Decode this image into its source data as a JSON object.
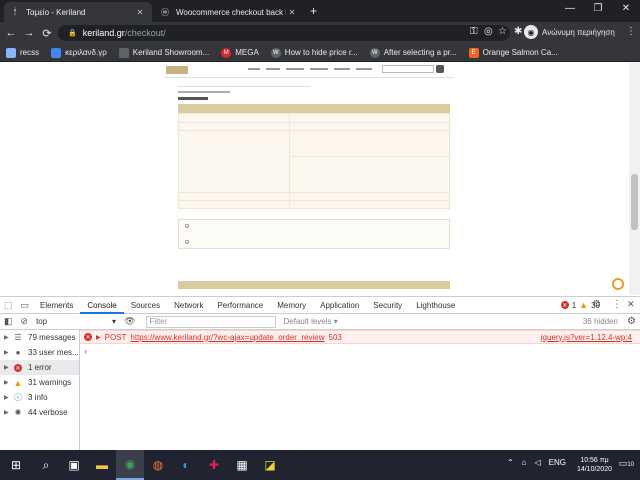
{
  "browser": {
    "tabs": [
      {
        "title": "Ταμείο - Keriland",
        "active": true
      },
      {
        "title": "Woocommerce checkout back 50",
        "active": false
      }
    ],
    "address": {
      "host": "keriland.gr",
      "path": "/checkout/"
    },
    "profile": {
      "label": "Ανώνυμη περιήγηση"
    },
    "bookmarks": [
      {
        "label": "recss",
        "icon": "bookmark-icon",
        "color": "#8ab4f8"
      },
      {
        "label": "κεριλανδ.γρ",
        "icon": "cloud-icon",
        "color": "#4285f4"
      },
      {
        "label": "Keriland Showroom...",
        "icon": "folder-icon",
        "color": "#5f6368"
      },
      {
        "label": "MEGA",
        "icon": "mega-icon",
        "color": "#d9272e"
      },
      {
        "label": "How to hide price r...",
        "icon": "wordpress-icon",
        "color": "#5f6368"
      },
      {
        "label": "After selecting a pr...",
        "icon": "wordpress-icon",
        "color": "#5f6368"
      },
      {
        "label": "Orange Salmon Ca...",
        "icon": "etsy-icon",
        "color": "#f1641e"
      }
    ]
  },
  "devtools": {
    "tabs": [
      "Elements",
      "Console",
      "Sources",
      "Network",
      "Performance",
      "Memory",
      "Application",
      "Security",
      "Lighthouse"
    ],
    "active_tab": "Console",
    "error_count": "1",
    "warning_count": "30",
    "context": "top",
    "filter_placeholder": "Filter",
    "levels": "Default levels ▾",
    "hidden": "36 hidden",
    "sidebar": [
      {
        "label": "79 messages",
        "icon": "list-icon"
      },
      {
        "label": "33 user mes...",
        "icon": "user-icon"
      },
      {
        "label": "1 error",
        "icon": "error-icon"
      },
      {
        "label": "31 warnings",
        "icon": "warning-icon"
      },
      {
        "label": "3 info",
        "icon": "info-icon"
      },
      {
        "label": "44 verbose",
        "icon": "verbose-icon"
      }
    ],
    "selected_sidebar": 2,
    "error_row": {
      "method": "POST",
      "url": "https://www.keriland.gr/?wc-ajax=update_order_review",
      "status": "503",
      "source": "jquery.js?ver=1.12.4-wp:4"
    }
  },
  "taskbar": {
    "tray": {
      "lang": "ENG"
    },
    "clock": {
      "time": "10:56 πμ",
      "date": "14/10/2020"
    },
    "notifications": "10"
  }
}
